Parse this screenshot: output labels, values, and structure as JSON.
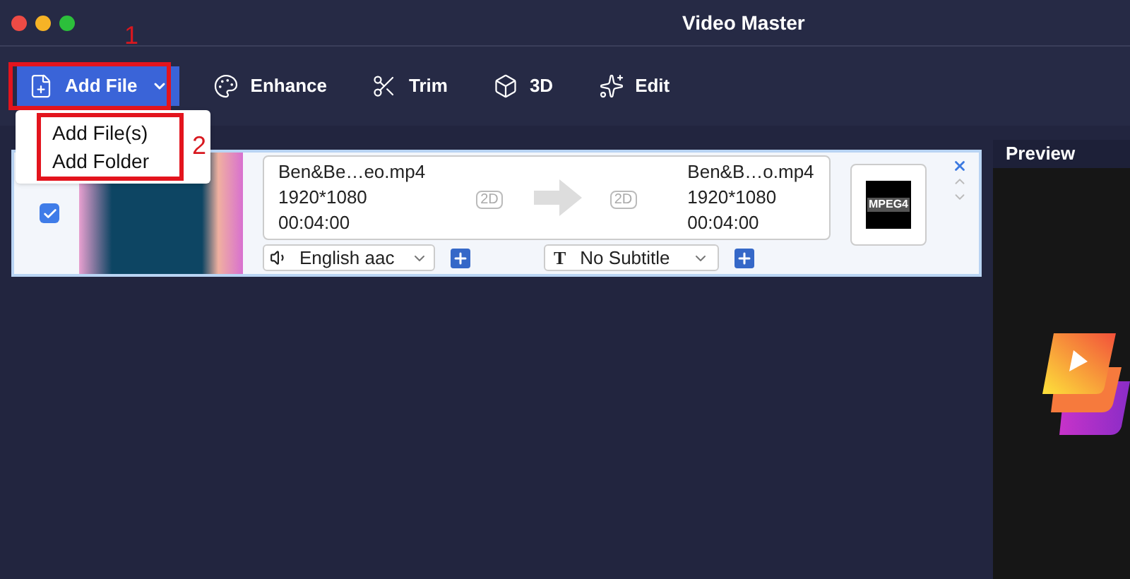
{
  "window": {
    "title": "Video Master"
  },
  "toolbar": [
    {
      "kind": "add",
      "label": "Add File",
      "selected": true
    },
    {
      "kind": "enhance",
      "label": "Enhance",
      "selected": false
    },
    {
      "kind": "trim",
      "label": "Trim",
      "selected": false
    },
    {
      "kind": "cube",
      "label": "3D",
      "selected": false
    },
    {
      "kind": "edit",
      "label": "Edit",
      "selected": false
    }
  ],
  "add_menu": {
    "expanded": true,
    "items": [
      "Add File(s)",
      "Add Folder"
    ]
  },
  "annotations": [
    "1",
    "2"
  ],
  "file": {
    "checked": true,
    "source": {
      "name": "Ben&Be…eo.mp4",
      "resolution": "1920*1080",
      "duration": "00:04:00",
      "badge": "2D"
    },
    "output": {
      "name": "Ben&B…o.mp4",
      "resolution": "1920*1080",
      "duration": "00:04:00",
      "badge": "2D"
    },
    "format_label": "MPEG4",
    "audio": "English aac",
    "subtitle": "No Subtitle",
    "subtitle_icon": "T"
  },
  "preview": {
    "title": "Preview"
  }
}
